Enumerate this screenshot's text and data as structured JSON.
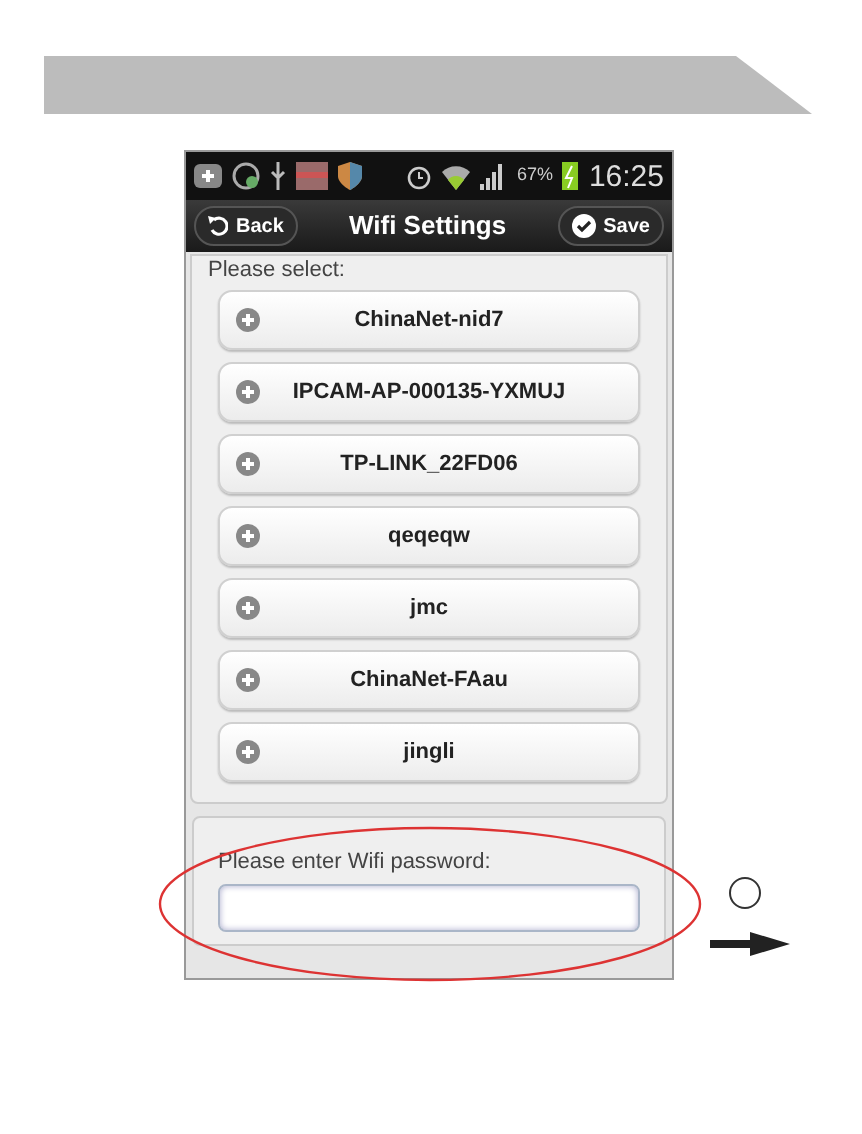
{
  "status_bar": {
    "battery": "67%",
    "time": "16:25"
  },
  "title_bar": {
    "back": "Back",
    "title": "Wifi Settings",
    "save": "Save"
  },
  "network_list": {
    "prompt": "Please select:",
    "networks": [
      {
        "name": "ChinaNet-nid7"
      },
      {
        "name": "IPCAM-AP-000135-YXMUJ"
      },
      {
        "name": "TP-LINK_22FD06"
      },
      {
        "name": "qeqeqw"
      },
      {
        "name": "jmc"
      },
      {
        "name": "ChinaNet-FAau"
      },
      {
        "name": "jingli"
      }
    ]
  },
  "password": {
    "label": "Please enter Wifi password:"
  }
}
